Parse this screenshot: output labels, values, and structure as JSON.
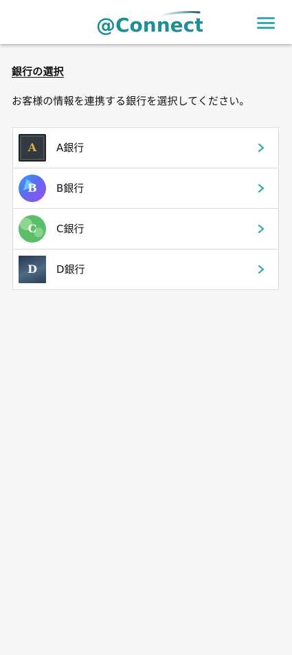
{
  "header": {
    "logo_text": "@Connect",
    "menu_icon": "hamburger-menu-icon",
    "brand_color": "#1f8f96",
    "brand_dark": "#1a5b7a"
  },
  "page": {
    "title": "銀行の選択",
    "description": "お客様の情報を連携する銀行を選択してください。"
  },
  "banks": [
    {
      "name": "A銀行",
      "logo_letter": "A",
      "icon": "chevron-right-icon"
    },
    {
      "name": "B銀行",
      "logo_letter": "B",
      "icon": "chevron-right-icon"
    },
    {
      "name": "C銀行",
      "logo_letter": "C",
      "icon": "chevron-right-icon"
    },
    {
      "name": "D銀行",
      "logo_letter": "D",
      "icon": "chevron-right-icon"
    }
  ],
  "colors": {
    "accent": "#37a9b1",
    "background": "#f8f7f8"
  }
}
